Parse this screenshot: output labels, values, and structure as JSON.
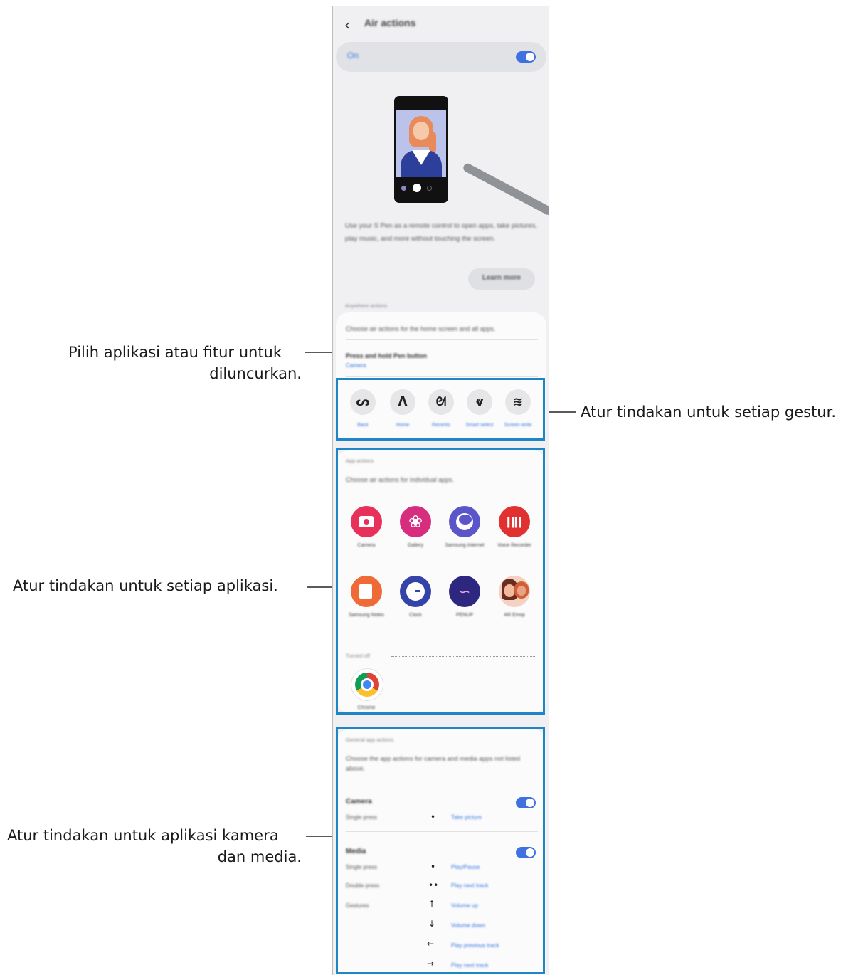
{
  "annotations": {
    "launch_app_line1": "Pilih aplikasi atau fitur untuk",
    "launch_app_line2": "diluncurkan.",
    "gestures": "Atur tindakan untuk setiap gestur.",
    "app_actions": "Atur tindakan untuk setiap aplikasi.",
    "camera_media_line1": "Atur tindakan untuk aplikasi kamera",
    "camera_media_line2": "dan media."
  },
  "screen": {
    "title": "Air actions",
    "master_switch": {
      "label": "On",
      "on": true
    },
    "description": "Use your S Pen as a remote control to open apps, take pictures, play music, and more without touching the screen.",
    "learn_more": "Learn more",
    "anywhere_section": {
      "header": "Anywhere actions",
      "subtitle": "Choose air actions for the home screen and all apps.",
      "press_hold_title": "Press and hold Pen button",
      "press_hold_value": "Camera",
      "gestures": [
        {
          "glyph": "ᔕ",
          "label": "Back",
          "icon": "gesture-back-icon"
        },
        {
          "glyph": "ᐱ",
          "label": "Home",
          "icon": "gesture-home-icon"
        },
        {
          "glyph": "ᘛ",
          "label": "Recents",
          "icon": "gesture-recents-icon"
        },
        {
          "glyph": "ⱴ",
          "label": "Smart select",
          "icon": "gesture-smart-select-icon"
        },
        {
          "glyph": "≋",
          "label": "Screen write",
          "icon": "gesture-screen-write-icon"
        }
      ]
    },
    "app_actions_section": {
      "header": "App actions",
      "subtitle": "Choose air actions for individual apps.",
      "apps": [
        {
          "name": "Camera",
          "icon": "camera-app-icon"
        },
        {
          "name": "Gallery",
          "icon": "gallery-app-icon"
        },
        {
          "name": "Samsung Internet",
          "icon": "samsung-internet-app-icon"
        },
        {
          "name": "Voice Recorder",
          "icon": "voice-recorder-app-icon"
        },
        {
          "name": "Samsung Notes",
          "icon": "samsung-notes-app-icon"
        },
        {
          "name": "Clock",
          "icon": "clock-app-icon"
        },
        {
          "name": "PENUP",
          "icon": "penup-app-icon"
        },
        {
          "name": "AR Emoji",
          "icon": "ar-emoji-app-icon"
        }
      ],
      "turned_off_label": "Turned off",
      "turned_off_apps": [
        {
          "name": "Chrome",
          "icon": "chrome-app-icon"
        }
      ]
    },
    "general_section": {
      "header": "General app actions",
      "subtitle": "Choose the app actions for camera and media apps not listed above.",
      "camera": {
        "title": "Camera",
        "on": true,
        "rows": [
          {
            "label": "Single press",
            "symbol": "•",
            "action": "Take picture"
          }
        ]
      },
      "media": {
        "title": "Media",
        "on": true,
        "rows": [
          {
            "label": "Single press",
            "symbol": "•",
            "action": "Play/Pause"
          },
          {
            "label": "Double press",
            "symbol": "••",
            "action": "Play next track"
          },
          {
            "label": "Gestures",
            "symbol": "↑",
            "action": "Volume up"
          },
          {
            "label": "",
            "symbol": "↓",
            "action": "Volume down"
          },
          {
            "label": "",
            "symbol": "←",
            "action": "Play previous track"
          },
          {
            "label": "",
            "symbol": "→",
            "action": "Play next track"
          }
        ]
      }
    }
  },
  "colors": {
    "accent_blue": "#3e7be0",
    "highlight_border": "#1e86c4",
    "camera_red": "#e8315a",
    "gallery_pink": "#d62d7f",
    "internet_indigo": "#5a56c9",
    "recorder_red": "#e0302f",
    "notes_orange": "#ef6a36",
    "clock_navy": "#3443a8",
    "penup_purple": "#2e2780"
  }
}
